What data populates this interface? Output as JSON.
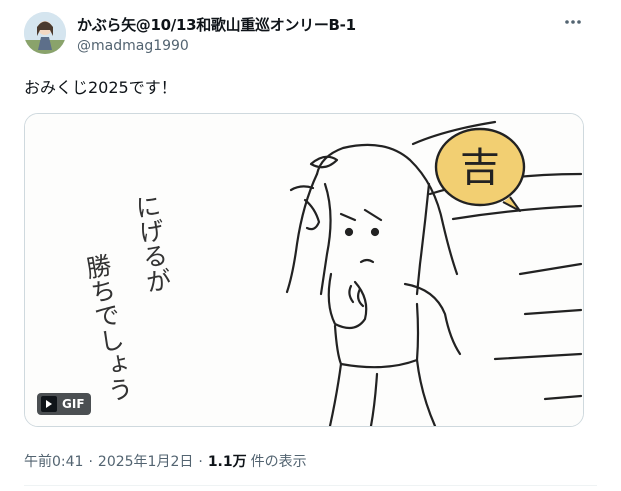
{
  "author": {
    "display_name": "かぶら矢@10/13和歌山重巡オンリーB-1",
    "handle": "@madmag1990"
  },
  "tweet": {
    "text": "おみくじ2025です！"
  },
  "media": {
    "badge_label": "GIF",
    "drawn_text": {
      "fortune": "吉",
      "line1": "にげるが",
      "line2": "勝ちでしょう"
    }
  },
  "meta": {
    "time": "午前0:41",
    "separator": "·",
    "date": "2025年1月2日",
    "views_count": "1.1万",
    "views_label": "件の表示"
  },
  "icons": {
    "more": "more-dots-icon",
    "play": "play-icon"
  }
}
